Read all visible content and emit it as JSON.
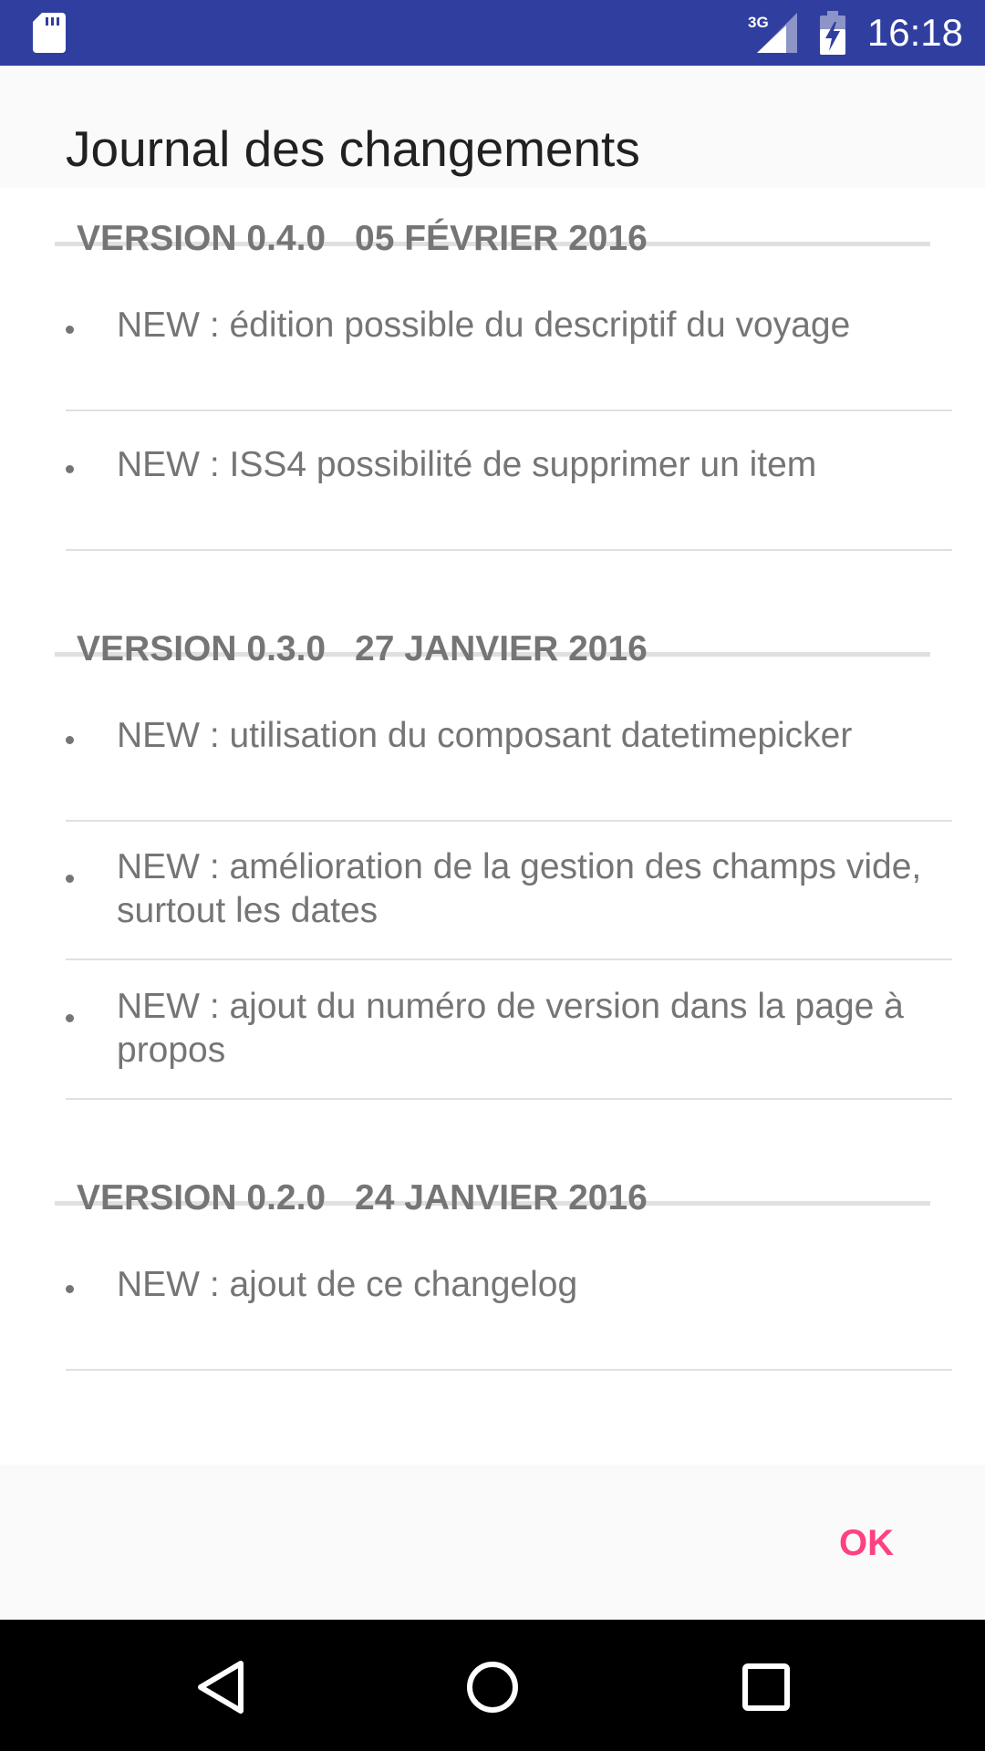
{
  "status_bar": {
    "time": "16:18",
    "network": "3G",
    "icons": [
      "sd-card-icon",
      "signal-3g-icon",
      "battery-charging-icon"
    ]
  },
  "dialog": {
    "title": "Journal des changements",
    "sections": [
      {
        "version": "VERSION 0.4.0",
        "date": "05 FÉVRIER 2016",
        "items": [
          "NEW : édition possible du descriptif du voyage",
          "NEW : ISS4 possibilité de supprimer un item"
        ]
      },
      {
        "version": "VERSION 0.3.0",
        "date": "27 JANVIER 2016",
        "items": [
          "NEW : utilisation du composant datetimepicker",
          "NEW : amélioration de la gestion des champs vide, surtout les dates",
          "NEW : ajout du numéro de version dans la page à propos"
        ]
      },
      {
        "version": "VERSION 0.2.0",
        "date": "24 JANVIER 2016",
        "items": [
          "NEW : ajout de ce changelog"
        ]
      }
    ],
    "ok_label": "OK"
  },
  "colors": {
    "status_bar": "#303F9F",
    "accent": "#FF4081",
    "text_secondary": "#757575",
    "title": "#212121"
  },
  "nav_bar": {
    "icons": [
      "back-icon",
      "home-icon",
      "recents-icon"
    ]
  }
}
